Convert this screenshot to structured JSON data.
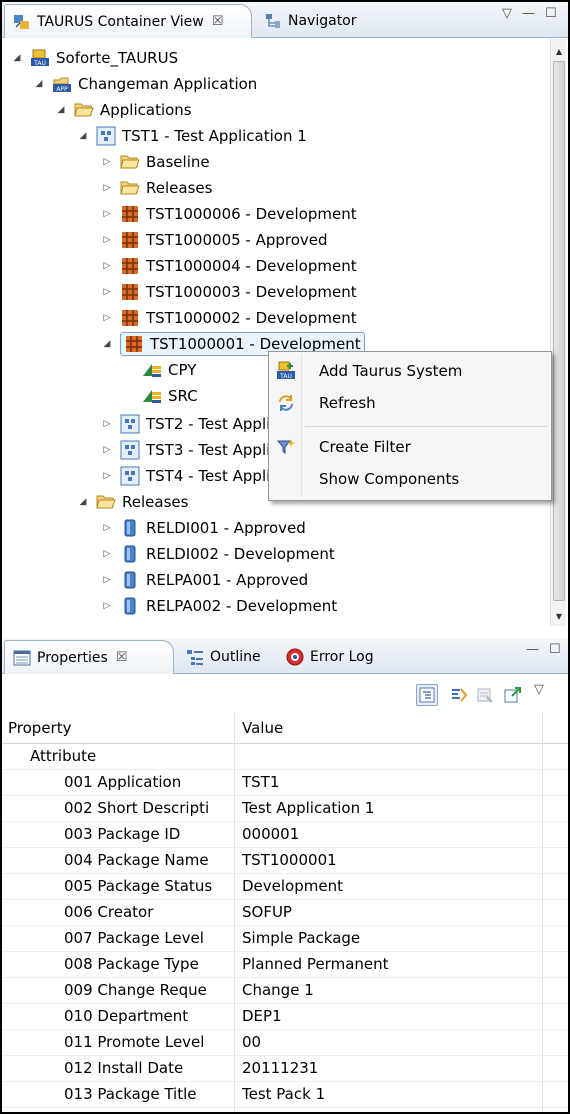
{
  "top_view": {
    "tabs": [
      {
        "label": "TAURUS Container View",
        "close": "☒"
      },
      {
        "label": "Navigator"
      }
    ],
    "controls": [
      "▽",
      "—",
      "☐"
    ]
  },
  "tree": {
    "nodes": [
      {
        "label": "Soforte_TAURUS"
      },
      {
        "label": "Changeman Application"
      },
      {
        "label": "Applications"
      },
      {
        "label": "TST1 - Test Application 1"
      },
      {
        "label": "Baseline"
      },
      {
        "label": "Releases"
      },
      {
        "label": "TST1000006 - Development"
      },
      {
        "label": "TST1000005 - Approved"
      },
      {
        "label": "TST1000004 - Development"
      },
      {
        "label": "TST1000003 - Development"
      },
      {
        "label": "TST1000002 - Development"
      },
      {
        "label": "TST1000001 - Development"
      },
      {
        "label": "CPY"
      },
      {
        "label": "SRC"
      },
      {
        "label": "TST2 - Test Application 2"
      },
      {
        "label": "TST3 - Test Application 3"
      },
      {
        "label": "TST4 - Test Application 4"
      },
      {
        "label": "Releases"
      },
      {
        "label": "RELDI001 - Approved"
      },
      {
        "label": "RELDI002 - Development"
      },
      {
        "label": "RELPA001 - Approved"
      },
      {
        "label": "RELPA002 - Development"
      }
    ]
  },
  "context_menu": {
    "items": [
      {
        "label": "Add Taurus System",
        "icon": "add-taurus-system-icon"
      },
      {
        "label": "Refresh",
        "icon": "refresh-icon"
      },
      {
        "label": "Create Filter",
        "icon": "create-filter-icon"
      },
      {
        "label": "Show Components"
      }
    ]
  },
  "bottom_view": {
    "tabs": [
      {
        "label": "Properties",
        "close": "☒"
      },
      {
        "label": "Outline"
      },
      {
        "label": "Error Log"
      }
    ],
    "controls": [
      "—",
      "☐"
    ]
  },
  "properties": {
    "col_property": "Property",
    "col_value": "Value",
    "category": "Attribute",
    "rows": [
      {
        "key": "001 Application",
        "value": "TST1"
      },
      {
        "key": "002 Short Descripti",
        "value": "Test Application 1"
      },
      {
        "key": "003 Package ID",
        "value": "000001"
      },
      {
        "key": "004 Package Name",
        "value": "TST1000001"
      },
      {
        "key": "005 Package Status",
        "value": "Development"
      },
      {
        "key": "006 Creator",
        "value": "SOFUP"
      },
      {
        "key": "007 Package Level",
        "value": "Simple Package"
      },
      {
        "key": "008 Package Type",
        "value": "Planned Permanent"
      },
      {
        "key": "009 Change Reque",
        "value": "Change 1"
      },
      {
        "key": "010 Department",
        "value": "DEP1"
      },
      {
        "key": "011 Promote Level",
        "value": "00"
      },
      {
        "key": "012 Install Date",
        "value": "20111231"
      },
      {
        "key": "013 Package Title",
        "value": "Test Pack 1"
      }
    ]
  }
}
